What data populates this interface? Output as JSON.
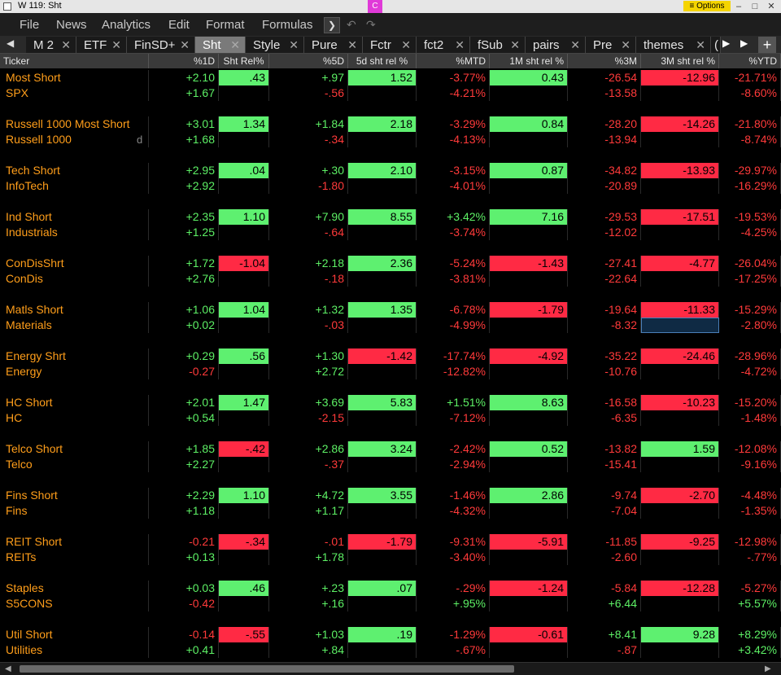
{
  "window": {
    "title": "W 119: Sht",
    "badge": "C",
    "options_label": "≡ Options",
    "min": "–",
    "restore": "□",
    "close": "✕"
  },
  "menu": {
    "items": [
      "File",
      "News",
      "Analytics",
      "Edit",
      "Format",
      "Formulas"
    ],
    "dropdown": "❯",
    "undo": "↶",
    "redo": "↷"
  },
  "tabs": [
    {
      "label": "M 2"
    },
    {
      "label": "ETF"
    },
    {
      "label": "FinSD+"
    },
    {
      "label": "Sht",
      "active": true
    },
    {
      "label": "Style"
    },
    {
      "label": "Pure"
    },
    {
      "label": "Fctr"
    },
    {
      "label": "fct2"
    },
    {
      "label": "fSub"
    },
    {
      "label": "pairs"
    },
    {
      "label": "Pre"
    },
    {
      "label": "themes"
    },
    {
      "label": "("
    }
  ],
  "tab_nav": {
    "left": "◀",
    "right": "▶",
    "right2": "▶",
    "add": "+"
  },
  "columns": [
    "Ticker",
    "%1D",
    "Sht Rel%",
    "%5D",
    "5d sht rel %",
    "%MTD",
    "1M sht rel %",
    "%3M",
    "3M sht rel %",
    "%YTD"
  ],
  "colors": {
    "orange": "#ff9e1a",
    "green_text": "#5df065",
    "red_text": "#ff3a3a",
    "green_fill": "#5ef070",
    "red_fill": "#ff2a44"
  },
  "rows": [
    {
      "ticker": "Most Short",
      "orange": true,
      "v": [
        "+2.10",
        ".43",
        "+.97",
        "1.52",
        "-3.77%",
        "0.43",
        "-26.54",
        "-12.96",
        "-21.71%"
      ],
      "f": [
        "",
        "g",
        "",
        "g",
        "",
        "g",
        "",
        "r",
        ""
      ]
    },
    {
      "ticker": "SPX",
      "orange": true,
      "v": [
        "+1.67",
        "",
        "-.56",
        "",
        "-4.21%",
        "",
        "-13.58",
        "",
        "-8.60%"
      ]
    },
    {
      "blank": true
    },
    {
      "ticker": "Russell 1000 Most Short",
      "orange": true,
      "v": [
        "+3.01",
        "1.34",
        "+1.84",
        "2.18",
        "-3.29%",
        "0.84",
        "-28.20",
        "-14.26",
        "-21.80%"
      ],
      "f": [
        "",
        "g",
        "",
        "g",
        "",
        "g",
        "",
        "r",
        ""
      ]
    },
    {
      "ticker": "Russell 1000",
      "orange": true,
      "dflag": "d",
      "v": [
        "+1.68",
        "",
        "-.34",
        "",
        "-4.13%",
        "",
        "-13.94",
        "",
        "-8.74%"
      ]
    },
    {
      "blank": true
    },
    {
      "ticker": "Tech Short",
      "orange": true,
      "v": [
        "+2.95",
        ".04",
        "+.30",
        "2.10",
        "-3.15%",
        "0.87",
        "-34.82",
        "-13.93",
        "-29.97%"
      ],
      "f": [
        "",
        "g",
        "",
        "g",
        "",
        "g",
        "",
        "r",
        ""
      ]
    },
    {
      "ticker": "InfoTech",
      "orange": true,
      "v": [
        "+2.92",
        "",
        "-1.80",
        "",
        "-4.01%",
        "",
        "-20.89",
        "",
        "-16.29%"
      ]
    },
    {
      "blank": true
    },
    {
      "ticker": "Ind Short",
      "orange": true,
      "v": [
        "+2.35",
        "1.10",
        "+7.90",
        "8.55",
        "+3.42%",
        "7.16",
        "-29.53",
        "-17.51",
        "-19.53%"
      ],
      "f": [
        "",
        "g",
        "",
        "g",
        "",
        "g",
        "",
        "r",
        ""
      ]
    },
    {
      "ticker": "Industrials",
      "orange": true,
      "v": [
        "+1.25",
        "",
        "-.64",
        "",
        "-3.74%",
        "",
        "-12.02",
        "",
        "-4.25%"
      ]
    },
    {
      "blank": true
    },
    {
      "ticker": "ConDisShrt",
      "orange": true,
      "v": [
        "+1.72",
        "-1.04",
        "+2.18",
        "2.36",
        "-5.24%",
        "-1.43",
        "-27.41",
        "-4.77",
        "-26.04%"
      ],
      "f": [
        "",
        "r",
        "",
        "g",
        "",
        "r",
        "",
        "r",
        ""
      ]
    },
    {
      "ticker": "ConDis",
      "orange": true,
      "v": [
        "+2.76",
        "",
        "-.18",
        "",
        "-3.81%",
        "",
        "-22.64",
        "",
        "-17.25%"
      ]
    },
    {
      "blank": true
    },
    {
      "ticker": "Matls Short",
      "orange": true,
      "v": [
        "+1.06",
        "1.04",
        "+1.32",
        "1.35",
        "-6.78%",
        "-1.79",
        "-19.64",
        "-11.33",
        "-15.29%"
      ],
      "f": [
        "",
        "g",
        "",
        "g",
        "",
        "r",
        "",
        "r",
        ""
      ]
    },
    {
      "ticker": "Materials",
      "orange": true,
      "v": [
        "+0.02",
        "",
        "-.03",
        "",
        "-4.99%",
        "",
        "-8.32",
        "",
        "-2.80%"
      ],
      "sel": 7
    },
    {
      "blank": true
    },
    {
      "ticker": "Energy Shrt",
      "orange": true,
      "v": [
        "+0.29",
        ".56",
        "+1.30",
        "-1.42",
        "-17.74%",
        "-4.92",
        "-35.22",
        "-24.46",
        "-28.96%"
      ],
      "f": [
        "",
        "g",
        "",
        "r",
        "",
        "r",
        "",
        "r",
        ""
      ]
    },
    {
      "ticker": "Energy",
      "orange": true,
      "v": [
        "-0.27",
        "",
        "+2.72",
        "",
        "-12.82%",
        "",
        "-10.76",
        "",
        "-4.72%"
      ]
    },
    {
      "blank": true
    },
    {
      "ticker": "HC Short",
      "orange": true,
      "v": [
        "+2.01",
        "1.47",
        "+3.69",
        "5.83",
        "+1.51%",
        "8.63",
        "-16.58",
        "-10.23",
        "-15.20%"
      ],
      "f": [
        "",
        "g",
        "",
        "g",
        "",
        "g",
        "",
        "r",
        ""
      ]
    },
    {
      "ticker": "HC",
      "orange": true,
      "v": [
        "+0.54",
        "",
        "-2.15",
        "",
        "-7.12%",
        "",
        "-6.35",
        "",
        "-1.48%"
      ]
    },
    {
      "blank": true
    },
    {
      "ticker": "Telco Short",
      "orange": true,
      "v": [
        "+1.85",
        "-.42",
        "+2.86",
        "3.24",
        "-2.42%",
        "0.52",
        "-13.82",
        "1.59",
        "-12.08%"
      ],
      "f": [
        "",
        "r",
        "",
        "g",
        "",
        "g",
        "",
        "g",
        ""
      ]
    },
    {
      "ticker": "Telco",
      "orange": true,
      "v": [
        "+2.27",
        "",
        "-.37",
        "",
        "-2.94%",
        "",
        "-15.41",
        "",
        "-9.16%"
      ]
    },
    {
      "blank": true
    },
    {
      "ticker": "Fins Short",
      "orange": true,
      "v": [
        "+2.29",
        "1.10",
        "+4.72",
        "3.55",
        "-1.46%",
        "2.86",
        "-9.74",
        "-2.70",
        "-4.48%"
      ],
      "f": [
        "",
        "g",
        "",
        "g",
        "",
        "g",
        "",
        "r",
        ""
      ]
    },
    {
      "ticker": "Fins",
      "orange": true,
      "v": [
        "+1.18",
        "",
        "+1.17",
        "",
        "-4.32%",
        "",
        "-7.04",
        "",
        "-1.35%"
      ]
    },
    {
      "blank": true
    },
    {
      "ticker": "REIT Short",
      "orange": true,
      "v": [
        "-0.21",
        "-.34",
        "-.01",
        "-1.79",
        "-9.31%",
        "-5.91",
        "-11.85",
        "-9.25",
        "-12.98%"
      ],
      "f": [
        "",
        "r",
        "",
        "r",
        "",
        "r",
        "",
        "r",
        ""
      ]
    },
    {
      "ticker": "REITs",
      "orange": true,
      "v": [
        "+0.13",
        "",
        "+1.78",
        "",
        "-3.40%",
        "",
        "-2.60",
        "",
        "-.77%"
      ]
    },
    {
      "blank": true
    },
    {
      "ticker": "Staples",
      "orange": true,
      "v": [
        "+0.03",
        ".46",
        "+.23",
        ".07",
        "-.29%",
        "-1.24",
        "-5.84",
        "-12.28",
        "-5.27%"
      ],
      "f": [
        "",
        "g",
        "",
        "g",
        "",
        "r",
        "",
        "r",
        ""
      ]
    },
    {
      "ticker": "S5CONS",
      "orange": true,
      "v": [
        "-0.42",
        "",
        "+.16",
        "",
        "+.95%",
        "",
        "+6.44",
        "",
        "+5.57%"
      ]
    },
    {
      "blank": true
    },
    {
      "ticker": "Util Short",
      "orange": true,
      "v": [
        "-0.14",
        "-.55",
        "+1.03",
        ".19",
        "-1.29%",
        "-0.61",
        "+8.41",
        "9.28",
        "+8.29%"
      ],
      "f": [
        "",
        "r",
        "",
        "g",
        "",
        "r",
        "",
        "g",
        ""
      ]
    },
    {
      "ticker": "Utilities",
      "orange": true,
      "v": [
        "+0.41",
        "",
        "+.84",
        "",
        "-.67%",
        "",
        "-.87",
        "",
        "+3.42%"
      ]
    }
  ],
  "scroll": {
    "left": "◀",
    "right": "▶",
    "thumb_fraction": 0.63
  }
}
